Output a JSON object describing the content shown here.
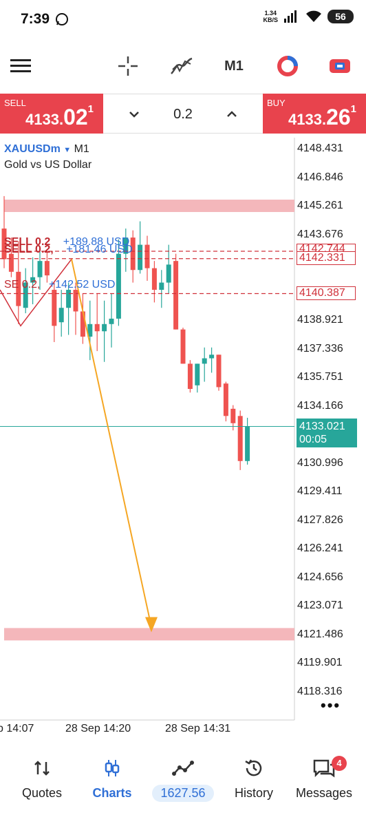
{
  "status_bar": {
    "time": "7:39",
    "net_speed_value": "1.34",
    "net_speed_unit": "KB/S",
    "battery": "56"
  },
  "toolbar": {
    "timeframe": "M1",
    "icons": [
      "menu-icon",
      "crosshair-icon",
      "indicators-icon",
      "timeframe-label",
      "trade-app-icon",
      "trading-toggle-icon"
    ]
  },
  "trade_panel": {
    "sell": {
      "label": "SELL",
      "price_prefix": "4133.",
      "price_big": "02",
      "price_sup": "1"
    },
    "buy": {
      "label": "BUY",
      "price_prefix": "4133.",
      "price_big": "26",
      "price_sup": "1"
    },
    "volume": "0.2"
  },
  "chart": {
    "symbol": "XAUUSDm",
    "timeframe": "M1",
    "description": "Gold vs US Dollar",
    "price_axis": [
      "4148.431",
      "4146.846",
      "4145.261",
      "4143.676",
      "4142.331",
      "4140.387",
      "4138.921",
      "4137.336",
      "4135.751",
      "4134.166",
      "4130.996",
      "4129.411",
      "4127.826",
      "4126.241",
      "4124.656",
      "4123.071",
      "4121.486",
      "4119.901",
      "4118.316"
    ],
    "line_badges": {
      "upper_partial": "4142.744",
      "order_high": "4142.331",
      "order_low": "4140.387"
    },
    "current": {
      "price": "4133.021",
      "countdown": "00:05"
    },
    "orders": [
      {
        "side": "SELL 0.2",
        "profit": "+189.88 USD"
      },
      {
        "side": "SELL 0.2,",
        "profit": "+181.46 USD"
      },
      {
        "side": "SE    0.2,",
        "profit": "+142.52 USD"
      }
    ],
    "time_axis": [
      "p 14:07",
      "28 Sep 14:20",
      "28 Sep 14:31"
    ],
    "colors": {
      "bull": "#26a69a",
      "bear": "#ef5350",
      "zone": "#f4b7bb",
      "arrow": "#f5a623",
      "order_line": "#d0303a"
    }
  },
  "chart_data": {
    "type": "candlestick",
    "title": "XAUUSDm M1",
    "ylim": [
      4117.5,
      4149.2
    ],
    "x_ticks": [
      "p 14:07",
      "28 Sep 14:20",
      "28 Sep 14:31"
    ],
    "candles": [
      {
        "o": 4144.0,
        "h": 4145.8,
        "l": 4141.8,
        "c": 4142.3
      },
      {
        "o": 4142.6,
        "h": 4143.5,
        "l": 4141.3,
        "c": 4141.6
      },
      {
        "o": 4141.6,
        "h": 4143.3,
        "l": 4138.7,
        "c": 4139.7
      },
      {
        "o": 4139.6,
        "h": 4141.8,
        "l": 4139.3,
        "c": 4141.0
      },
      {
        "o": 4141.0,
        "h": 4142.4,
        "l": 4139.8,
        "c": 4141.3
      },
      {
        "o": 4141.3,
        "h": 4142.9,
        "l": 4140.6,
        "c": 4142.2
      },
      {
        "o": 4142.2,
        "h": 4142.8,
        "l": 4141.0,
        "c": 4141.4
      },
      {
        "o": 4140.6,
        "h": 4141.0,
        "l": 4137.7,
        "c": 4138.6
      },
      {
        "o": 4138.8,
        "h": 4140.6,
        "l": 4138.0,
        "c": 4139.6
      },
      {
        "o": 4139.6,
        "h": 4141.0,
        "l": 4138.1,
        "c": 4140.6
      },
      {
        "o": 4140.6,
        "h": 4141.0,
        "l": 4138.1,
        "c": 4139.4
      },
      {
        "o": 4139.4,
        "h": 4140.4,
        "l": 4137.6,
        "c": 4138.0
      },
      {
        "o": 4138.0,
        "h": 4140.0,
        "l": 4136.7,
        "c": 4138.7
      },
      {
        "o": 4138.7,
        "h": 4140.4,
        "l": 4137.2,
        "c": 4138.3
      },
      {
        "o": 4138.3,
        "h": 4140.0,
        "l": 4136.6,
        "c": 4138.7
      },
      {
        "o": 4138.7,
        "h": 4140.4,
        "l": 4137.4,
        "c": 4139.0
      },
      {
        "o": 4139.0,
        "h": 4143.4,
        "l": 4138.6,
        "c": 4142.6
      },
      {
        "o": 4142.6,
        "h": 4144.0,
        "l": 4141.6,
        "c": 4143.5
      },
      {
        "o": 4143.5,
        "h": 4143.9,
        "l": 4141.0,
        "c": 4141.7
      },
      {
        "o": 4141.7,
        "h": 4144.4,
        "l": 4141.5,
        "c": 4143.1
      },
      {
        "o": 4143.1,
        "h": 4143.6,
        "l": 4141.1,
        "c": 4141.8
      },
      {
        "o": 4141.8,
        "h": 4142.2,
        "l": 4139.9,
        "c": 4140.6
      },
      {
        "o": 4140.6,
        "h": 4141.7,
        "l": 4139.6,
        "c": 4141.0
      },
      {
        "o": 4141.0,
        "h": 4143.1,
        "l": 4140.4,
        "c": 4142.0
      },
      {
        "o": 4142.2,
        "h": 4142.6,
        "l": 4138.4,
        "c": 4138.4
      },
      {
        "o": 4138.4,
        "h": 4138.5,
        "l": 4136.5,
        "c": 4136.5
      },
      {
        "o": 4136.5,
        "h": 4136.7,
        "l": 4134.9,
        "c": 4135.1
      },
      {
        "o": 4135.3,
        "h": 4136.5,
        "l": 4134.9,
        "c": 4136.5
      },
      {
        "o": 4136.5,
        "h": 4137.4,
        "l": 4135.5,
        "c": 4136.8
      },
      {
        "o": 4136.8,
        "h": 4137.4,
        "l": 4136.0,
        "c": 4137.0
      },
      {
        "o": 4137.0,
        "h": 4137.0,
        "l": 4135.0,
        "c": 4135.2
      },
      {
        "o": 4135.4,
        "h": 4135.5,
        "l": 4133.3,
        "c": 4133.6
      },
      {
        "o": 4134.0,
        "h": 4134.2,
        "l": 4132.8,
        "c": 4133.2
      },
      {
        "o": 4133.6,
        "h": 4133.9,
        "l": 4130.6,
        "c": 4131.1
      },
      {
        "o": 4131.1,
        "h": 4133.5,
        "l": 4130.9,
        "c": 4133.0
      }
    ],
    "horizontal_zones": [
      4145.26,
      4121.49
    ],
    "order_lines": [
      4142.74,
      4142.33,
      4140.39
    ],
    "current_price": 4133.021
  },
  "bottom_nav": {
    "items": [
      {
        "label": "Quotes",
        "icon": "quotes-icon"
      },
      {
        "label": "Charts",
        "icon": "charts-icon"
      },
      {
        "label": "1627.56",
        "icon": "trade-icon"
      },
      {
        "label": "History",
        "icon": "history-icon"
      },
      {
        "label": "Messages",
        "icon": "messages-icon",
        "badge": "4"
      }
    ]
  }
}
